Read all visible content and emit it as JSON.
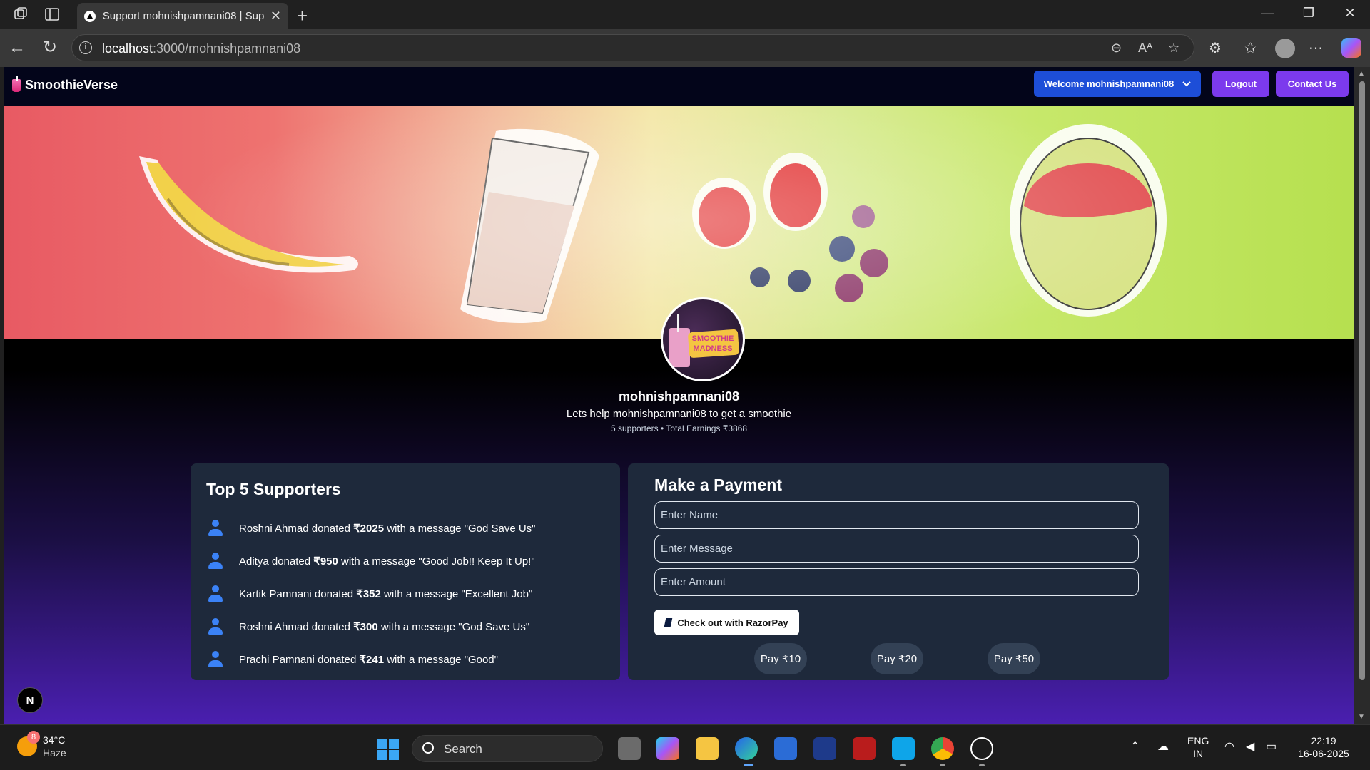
{
  "browser": {
    "tab_title": "Support mohnishpamnani08 | Sup",
    "url_host": "localhost",
    "url_path": ":3000/mohnishpamnani08"
  },
  "site": {
    "brand": "SmoothieVerse",
    "welcome_label": "Welcome mohnishpamnani08",
    "logout_label": "Logout",
    "contact_label": "Contact Us"
  },
  "profile": {
    "username": "mohnishpamnani08",
    "tagline": "Lets help mohnishpamnani08 to get a smoothie",
    "stats": "5 supporters • Total Earnings ₹3868",
    "avatar_text": "SMOOTHIE MADNESS"
  },
  "supporters": {
    "title": "Top 5 Supporters",
    "items": [
      {
        "name": "Roshni Ahmad",
        "amount": "₹2025",
        "message": "\"God Save Us\""
      },
      {
        "name": "Aditya",
        "amount": "₹950",
        "message": "\"Good Job!! Keep It Up!\""
      },
      {
        "name": "Kartik Pamnani",
        "amount": "₹352",
        "message": "\"Excellent Job\""
      },
      {
        "name": "Roshni Ahmad",
        "amount": "₹300",
        "message": "\"God Save Us\""
      },
      {
        "name": "Prachi Pamnani",
        "amount": "₹241",
        "message": "\"Good\""
      }
    ],
    "donated_word": "donated",
    "with_msg": "with a message"
  },
  "payment": {
    "title": "Make a Payment",
    "name_placeholder": "Enter Name",
    "message_placeholder": "Enter Message",
    "amount_placeholder": "Enter Amount",
    "checkout_label": "Check out with RazorPay",
    "quick": [
      "Pay ₹10",
      "Pay ₹20",
      "Pay ₹50"
    ]
  },
  "dev_badge": "N",
  "taskbar": {
    "temperature": "34°C",
    "condition": "Haze",
    "weather_badge": "8",
    "search_label": "Search",
    "lang_top": "ENG",
    "lang_bottom": "IN",
    "time": "22:19",
    "date": "16-06-2025"
  }
}
